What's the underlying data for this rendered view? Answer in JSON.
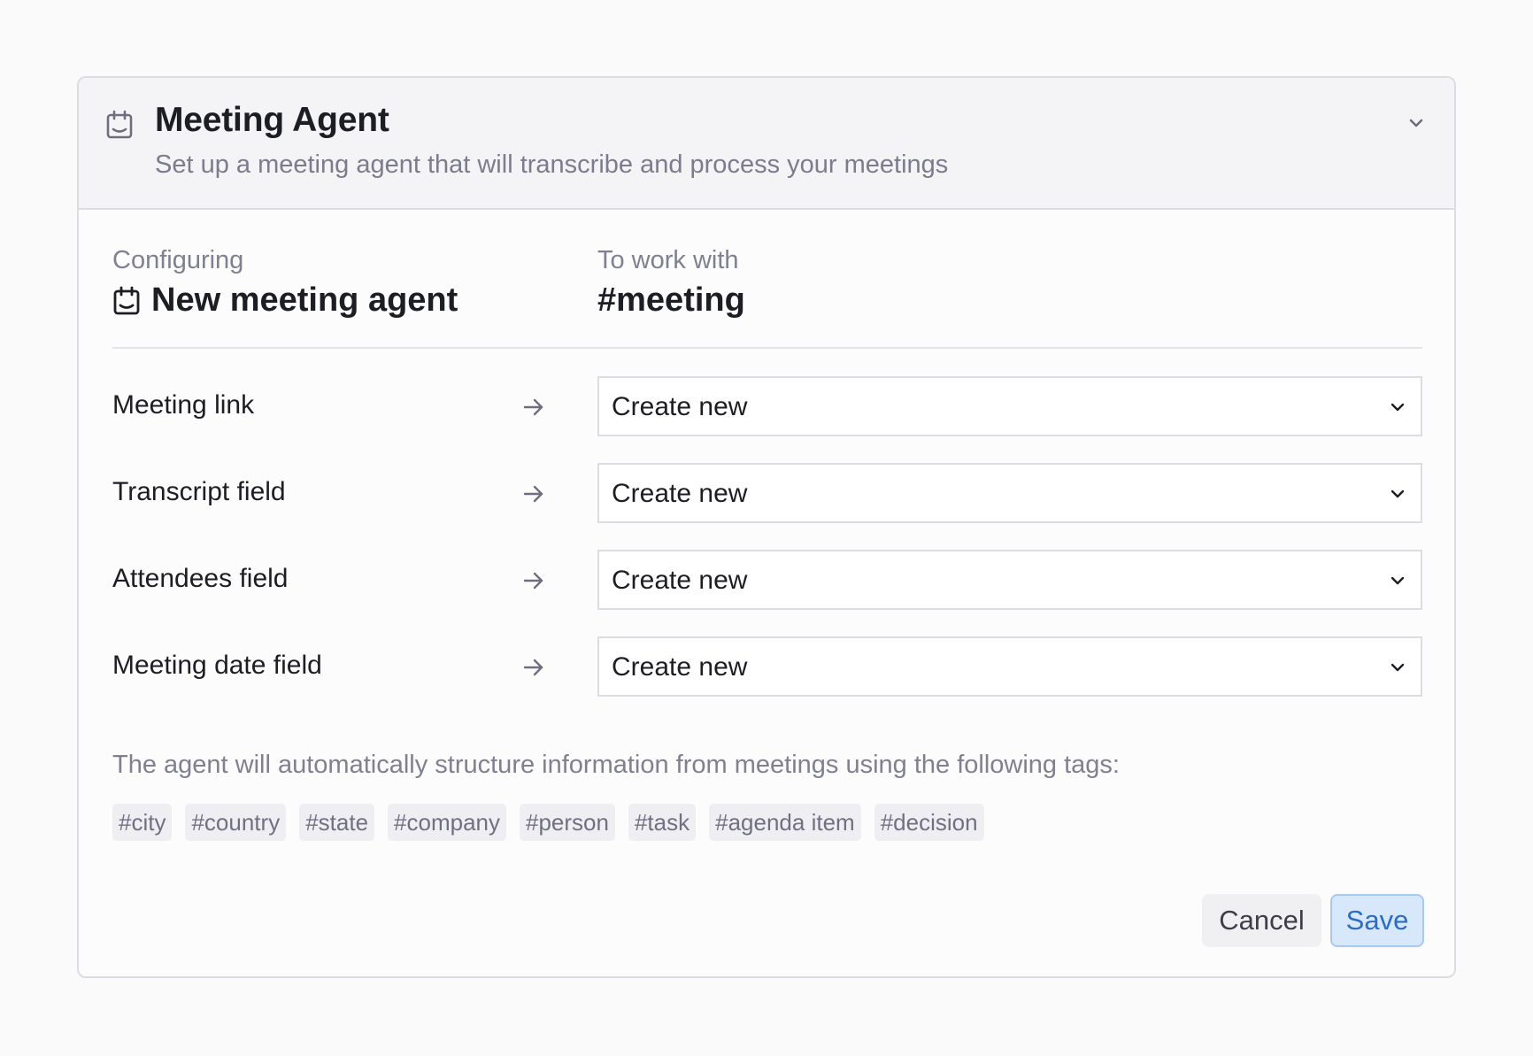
{
  "header": {
    "icon": "calendar-icon",
    "title": "Meeting Agent",
    "subtitle": "Set up a meeting agent that will transcribe and process your meetings"
  },
  "config": {
    "configuring_label": "Configuring",
    "agent_name": "New meeting agent",
    "work_with_label": "To work with",
    "target_tag": "#meeting"
  },
  "mappings": [
    {
      "label": "Meeting link",
      "value": "Create new"
    },
    {
      "label": "Transcript field",
      "value": "Create new"
    },
    {
      "label": "Attendees field",
      "value": "Create new"
    },
    {
      "label": "Meeting date field",
      "value": "Create new"
    }
  ],
  "tags_intro": "The agent will automatically structure information from meetings using the following tags:",
  "tags": [
    "#city",
    "#country",
    "#state",
    "#company",
    "#person",
    "#task",
    "#agenda item",
    "#decision"
  ],
  "actions": {
    "cancel_label": "Cancel",
    "save_label": "Save"
  },
  "colors": {
    "accent": "#2b6cc4",
    "save_bg": "#d8e8fb",
    "muted_text": "#808090"
  }
}
